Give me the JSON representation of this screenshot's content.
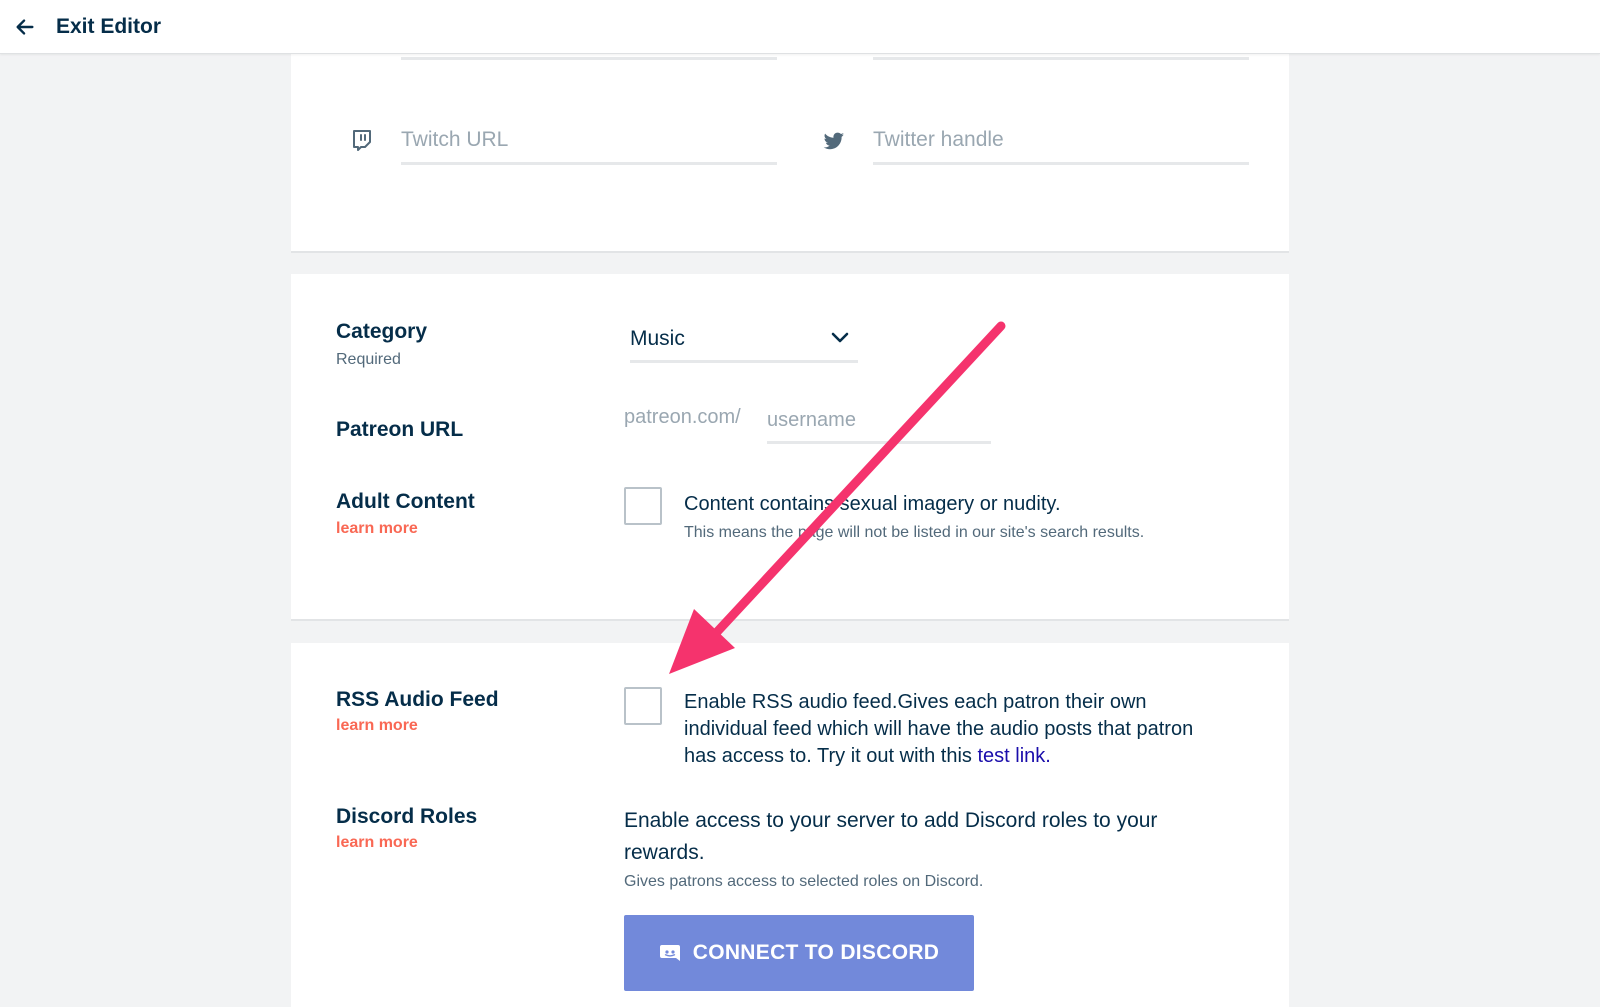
{
  "header": {
    "back_icon": "arrow-left-icon",
    "exit_label": "Exit Editor"
  },
  "social": {
    "twitch": {
      "icon": "twitch-icon",
      "placeholder": "Twitch URL",
      "value": ""
    },
    "twitter": {
      "icon": "twitter-icon",
      "placeholder": "Twitter handle",
      "value": ""
    }
  },
  "settings": {
    "category": {
      "label": "Category",
      "sub": "Required",
      "value": "Music"
    },
    "patreon_url": {
      "label": "Patreon URL",
      "prefix": "patreon.com/",
      "placeholder": "username",
      "value": ""
    },
    "adult": {
      "label": "Adult Content",
      "learn_more": "learn more",
      "checkbox_label": "Content contains sexual imagery or nudity.",
      "note": "This means the page will not be listed in our site's search results.",
      "checked": false
    }
  },
  "features": {
    "rss": {
      "label": "RSS Audio Feed",
      "learn_more": "learn more",
      "text": "Enable RSS audio feed.Gives each patron their own individual feed which will have the audio posts that patron has access to. Try it out with this ",
      "link": "test link.",
      "checked": false
    },
    "discord": {
      "label": "Discord Roles",
      "learn_more": "learn more",
      "text": "Enable access to your server to add Discord roles to your rewards.",
      "note": "Gives patrons access to selected roles on Discord.",
      "button_label": "CONNECT TO DISCORD",
      "button_icon": "discord-icon"
    }
  },
  "colors": {
    "primary_text": "#052d49",
    "accent_coral": "#f96854",
    "discord_blue": "#7289da",
    "annotation_arrow": "#f5336d"
  }
}
